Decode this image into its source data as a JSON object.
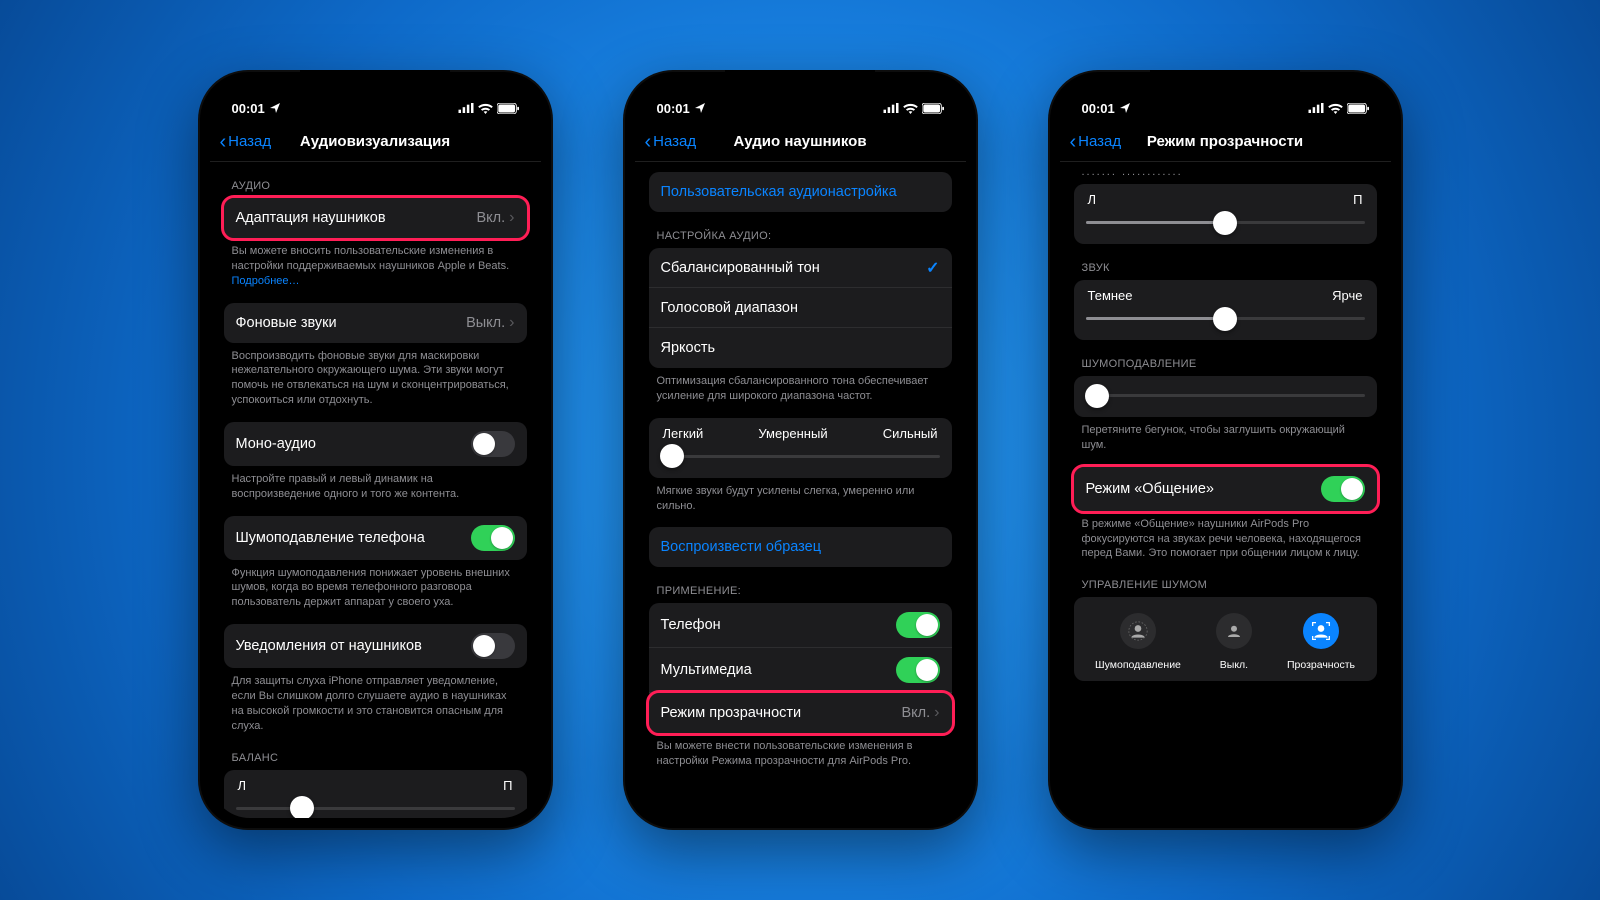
{
  "status": {
    "time": "00:01"
  },
  "nav": {
    "back": "Назад"
  },
  "phone1": {
    "title": "Аудиовизуализация",
    "section_audio": "АУДИО",
    "headphone_accom": {
      "label": "Адаптация наушников",
      "value": "Вкл."
    },
    "accom_footer": "Вы можете вносить пользовательские изменения в настройки поддерживаемых наушников Apple и Beats. ",
    "accom_more": "Подробнее…",
    "bg_sounds": {
      "label": "Фоновые звуки",
      "value": "Выкл."
    },
    "bg_footer": "Воспроизводить фоновые звуки для маскировки нежелательного окружающего шума. Эти звуки могут помочь не отвлекаться на шум и сконцентрироваться, успокоиться или отдохнуть.",
    "mono": {
      "label": "Моно-аудио"
    },
    "mono_footer": "Настройте правый и левый динамик на воспроизведение одного и того же контента.",
    "noise_cancel": {
      "label": "Шумоподавление телефона"
    },
    "noise_footer": "Функция шумоподавления понижает уровень внешних шумов, когда во время телефонного разговора пользователь держит аппарат у своего уха.",
    "notif": {
      "label": "Уведомления от наушников"
    },
    "notif_footer": "Для защиты слуха iPhone отправляет уведомление, если Вы слишком долго слушаете аудио в наушниках на высокой громкости и это становится опасным для слуха.",
    "balance_header": "БАЛАНС",
    "balance_left": "Л",
    "balance_right": "П"
  },
  "phone2": {
    "title": "Аудио наушников",
    "custom_setup": "Пользовательская аудионастройка",
    "section_tune": "НАСТРОЙКА АУДИО:",
    "opt_balanced": "Сбалансированный тон",
    "opt_vocal": "Голосовой диапазон",
    "opt_bright": "Яркость",
    "tune_footer": "Оптимизация сбалансированного тона обеспечивает усиление для широкого диапазона частот.",
    "slider_slight": "Легкий",
    "slider_moderate": "Умеренный",
    "slider_strong": "Сильный",
    "slider_footer": "Мягкие звуки будут усилены слегка, умеренно или сильно.",
    "play_sample": "Воспроизвести образец",
    "section_apply": "ПРИМЕНЕНИЕ:",
    "apply_phone": "Телефон",
    "apply_media": "Мультимедиа",
    "transparency": {
      "label": "Режим прозрачности",
      "value": "Вкл."
    },
    "trans_footer": "Вы можете внести пользовательские изменения в настройки Режима прозрачности для AirPods Pro."
  },
  "phone3": {
    "title": "Режим прозрачности",
    "balance_partial": "БАЛАНС ПРОЗРАЧНОСТИ",
    "balance_left": "Л",
    "balance_right": "П",
    "section_sound": "ЗВУК",
    "sound_dark": "Темнее",
    "sound_bright": "Ярче",
    "section_noise": "ШУМОПОДАВЛЕНИЕ",
    "noise_footer": "Перетяните бегунок, чтобы заглушить окружающий шум.",
    "conversation": {
      "label": "Режим «Общение»"
    },
    "conv_footer": "В режиме «Общение» наушники AirPods Pro фокусируются на звуках речи человека, находящегося перед Вами. Это помогает при общении лицом к лицу.",
    "section_control": "УПРАВЛЕНИЕ ШУМОМ",
    "mode_nc": "Шумоподавление",
    "mode_off": "Выкл.",
    "mode_trans": "Прозрачность"
  }
}
